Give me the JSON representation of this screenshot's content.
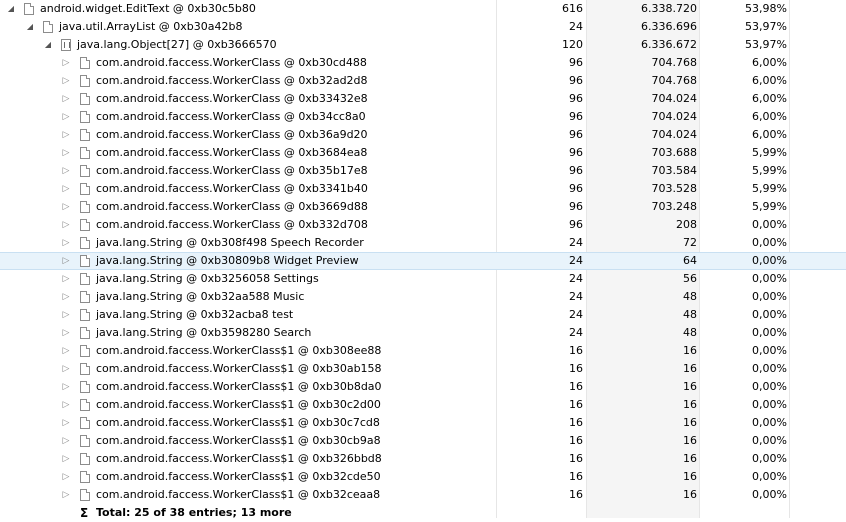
{
  "rows": [
    {
      "label": "android.widget.EditText @ 0xb30c5b80",
      "shallow": "616",
      "retained": "6.338.720",
      "percent": "53,98%"
    },
    {
      "label": "java.util.ArrayList @ 0xb30a42b8",
      "shallow": "24",
      "retained": "6.336.696",
      "percent": "53,97%"
    },
    {
      "label": "java.lang.Object[27] @ 0xb3666570",
      "shallow": "120",
      "retained": "6.336.672",
      "percent": "53,97%"
    },
    {
      "label": "com.android.faccess.WorkerClass @ 0xb30cd488",
      "shallow": "96",
      "retained": "704.768",
      "percent": "6,00%"
    },
    {
      "label": "com.android.faccess.WorkerClass @ 0xb32ad2d8",
      "shallow": "96",
      "retained": "704.768",
      "percent": "6,00%"
    },
    {
      "label": "com.android.faccess.WorkerClass @ 0xb33432e8",
      "shallow": "96",
      "retained": "704.024",
      "percent": "6,00%"
    },
    {
      "label": "com.android.faccess.WorkerClass @ 0xb34cc8a0",
      "shallow": "96",
      "retained": "704.024",
      "percent": "6,00%"
    },
    {
      "label": "com.android.faccess.WorkerClass @ 0xb36a9d20",
      "shallow": "96",
      "retained": "704.024",
      "percent": "6,00%"
    },
    {
      "label": "com.android.faccess.WorkerClass @ 0xb3684ea8",
      "shallow": "96",
      "retained": "703.688",
      "percent": "5,99%"
    },
    {
      "label": "com.android.faccess.WorkerClass @ 0xb35b17e8",
      "shallow": "96",
      "retained": "703.584",
      "percent": "5,99%"
    },
    {
      "label": "com.android.faccess.WorkerClass @ 0xb3341b40",
      "shallow": "96",
      "retained": "703.528",
      "percent": "5,99%"
    },
    {
      "label": "com.android.faccess.WorkerClass @ 0xb3669d88",
      "shallow": "96",
      "retained": "703.248",
      "percent": "5,99%"
    },
    {
      "label": "com.android.faccess.WorkerClass @ 0xb332d708",
      "shallow": "96",
      "retained": "208",
      "percent": "0,00%"
    },
    {
      "label": "java.lang.String @ 0xb308f498  Speech Recorder",
      "shallow": "24",
      "retained": "72",
      "percent": "0,00%"
    },
    {
      "label": "java.lang.String @ 0xb30809b8  Widget Preview",
      "shallow": "24",
      "retained": "64",
      "percent": "0,00%"
    },
    {
      "label": "java.lang.String @ 0xb3256058  Settings",
      "shallow": "24",
      "retained": "56",
      "percent": "0,00%"
    },
    {
      "label": "java.lang.String @ 0xb32aa588  Music",
      "shallow": "24",
      "retained": "48",
      "percent": "0,00%"
    },
    {
      "label": "java.lang.String @ 0xb32acba8  test",
      "shallow": "24",
      "retained": "48",
      "percent": "0,00%"
    },
    {
      "label": "java.lang.String @ 0xb3598280  Search",
      "shallow": "24",
      "retained": "48",
      "percent": "0,00%"
    },
    {
      "label": "com.android.faccess.WorkerClass$1 @ 0xb308ee88",
      "shallow": "16",
      "retained": "16",
      "percent": "0,00%"
    },
    {
      "label": "com.android.faccess.WorkerClass$1 @ 0xb30ab158",
      "shallow": "16",
      "retained": "16",
      "percent": "0,00%"
    },
    {
      "label": "com.android.faccess.WorkerClass$1 @ 0xb30b8da0",
      "shallow": "16",
      "retained": "16",
      "percent": "0,00%"
    },
    {
      "label": "com.android.faccess.WorkerClass$1 @ 0xb30c2d00",
      "shallow": "16",
      "retained": "16",
      "percent": "0,00%"
    },
    {
      "label": "com.android.faccess.WorkerClass$1 @ 0xb30c7cd8",
      "shallow": "16",
      "retained": "16",
      "percent": "0,00%"
    },
    {
      "label": "com.android.faccess.WorkerClass$1 @ 0xb30cb9a8",
      "shallow": "16",
      "retained": "16",
      "percent": "0,00%"
    },
    {
      "label": "com.android.faccess.WorkerClass$1 @ 0xb326bbd8",
      "shallow": "16",
      "retained": "16",
      "percent": "0,00%"
    },
    {
      "label": "com.android.faccess.WorkerClass$1 @ 0xb32cde50",
      "shallow": "16",
      "retained": "16",
      "percent": "0,00%"
    },
    {
      "label": "com.android.faccess.WorkerClass$1 @ 0xb32ceaa8",
      "shallow": "16",
      "retained": "16",
      "percent": "0,00%"
    }
  ],
  "total": {
    "symbol": "Σ",
    "label": "Total: 25 of 38 entries; 13 more"
  },
  "colors": {
    "selected_row_bg": "#e8f3fb",
    "retained_column_bg": "#f5f5f5",
    "column_separator": "#e6e6e6"
  },
  "icons": {
    "expanded": "triangle-down",
    "collapsed": "triangle-right",
    "object": "document-icon",
    "array": "array-icon"
  }
}
